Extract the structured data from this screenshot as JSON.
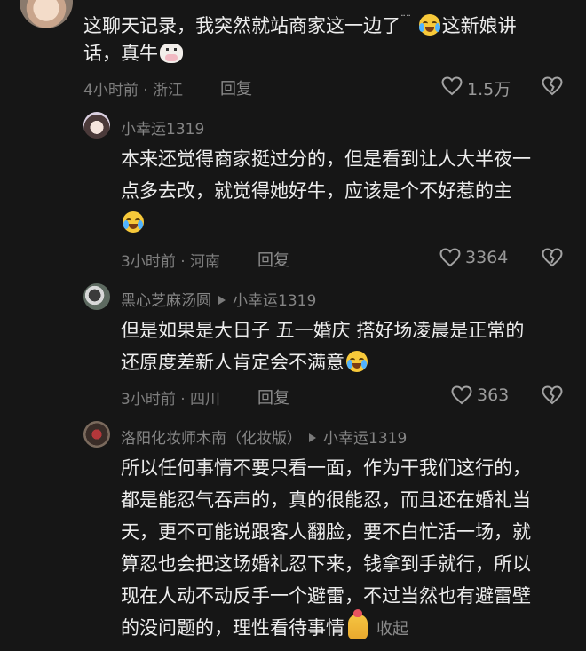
{
  "top_comment": {
    "line1_a": "这聊天记录，我突然就站商家这一边了",
    "line1_b": "这新娘讲",
    "line2": "话，真牛",
    "meta": "4小时前 · 浙江",
    "reply_label": "回复",
    "like_count": "1.5万"
  },
  "replies": [
    {
      "username": "小幸运1319",
      "lines": [
        "本来还觉得商家挺过分的，但是看到让人大半夜一",
        "点多去改，就觉得她好牛，应该是个不好惹的主"
      ],
      "meta": "3小时前 · 河南",
      "reply_label": "回复",
      "like_count": "3364"
    },
    {
      "username": "黑心芝麻汤圆",
      "reply_to": "小幸运1319",
      "lines": [
        "但是如果是大日子 五一婚庆 搭好场凌晨是正常的",
        "还原度差新人肯定会不满意"
      ],
      "meta": "3小时前 · 四川",
      "reply_label": "回复",
      "like_count": "363"
    },
    {
      "username": "洛阳化妆师木南（化妆版）",
      "reply_to": "小幸运1319",
      "lines": [
        "所以任何事情不要只看一面，作为干我们这行的，",
        "都是能忍气吞声的，真的很能忍，而且还在婚礼当",
        "天，更不可能说跟客人翻脸，要不白忙活一场，就",
        "算忍也会把这场婚礼忍下来，钱拿到手就行，所以",
        "现在人动不动反手一个避雷，不过当然也有避雷壁",
        "的没问题的，理性看待事情"
      ],
      "collapse_label": "收起"
    }
  ],
  "icons": [
    "heart-icon",
    "dislike-heart-icon",
    "play-triangle-icon",
    "crying-laughing-emoji",
    "cow-emoji",
    "crying-emoji",
    "praying-hands-emoji"
  ],
  "colors": {
    "background": "#161616",
    "text": "#ececec",
    "secondary": "#7d7d7d"
  }
}
